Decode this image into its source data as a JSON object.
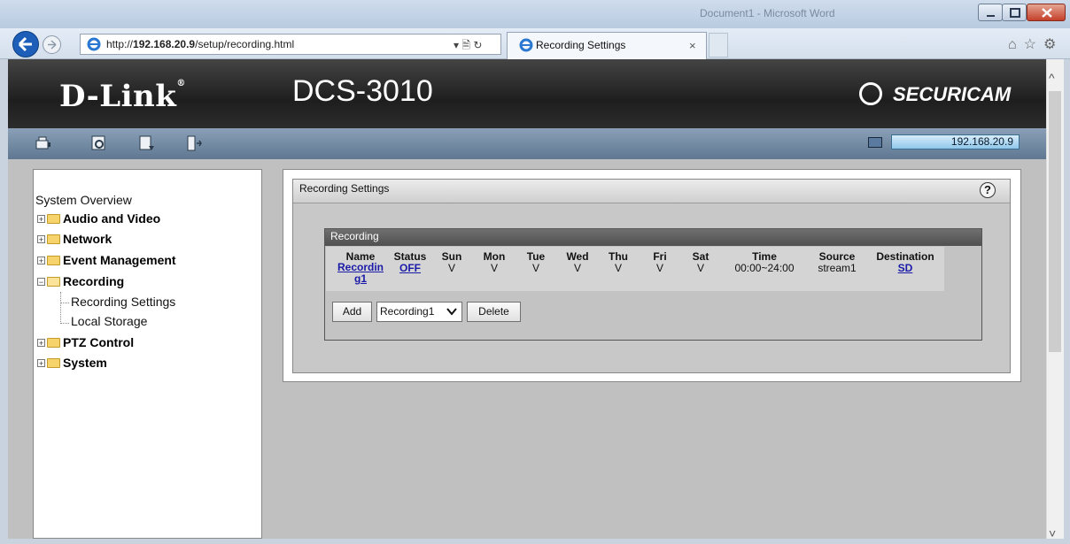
{
  "window": {
    "title": "Document1 - Microsoft Word"
  },
  "browser": {
    "address_prefix": "http://",
    "address_host": "192.168.20.9",
    "address_path": "/setup/recording.html",
    "address_controls": "▾ 🗎 ↻",
    "tab_title": "Recording Settings",
    "tab_close": "×"
  },
  "header": {
    "logo": "D-Link",
    "logo_mark": "®",
    "model": "DCS-3010",
    "brand": "SECURICAM"
  },
  "menubar": {
    "icons": [
      "camera-icon",
      "live-view-icon",
      "setup-icon",
      "logout-icon"
    ],
    "ip": "192.168.20.9"
  },
  "tree": {
    "overview": "System Overview",
    "items": [
      {
        "label": "Audio and Video",
        "expander": "+"
      },
      {
        "label": "Network",
        "expander": "+"
      },
      {
        "label": "Event Management",
        "expander": "+"
      },
      {
        "label": "Recording",
        "expander": "−"
      },
      {
        "label": "PTZ Control",
        "expander": "+"
      },
      {
        "label": "System",
        "expander": "+"
      }
    ],
    "recording_children": [
      "Recording Settings",
      "Local Storage"
    ]
  },
  "main": {
    "section_title": "Recording Settings",
    "help": "?",
    "recording": {
      "title": "Recording",
      "columns": [
        "Name",
        "Status",
        "Sun",
        "Mon",
        "Tue",
        "Wed",
        "Thu",
        "Fri",
        "Sat",
        "Time",
        "Source",
        "Destination"
      ],
      "row": {
        "name_line1": "Recordin",
        "name_line2": "g1",
        "status": "OFF",
        "days": [
          "V",
          "V",
          "V",
          "V",
          "V",
          "V",
          "V"
        ],
        "time": "00:00~24:00",
        "source": "stream1",
        "destination": "SD"
      },
      "add_label": "Add",
      "select_value": "Recording1",
      "delete_label": "Delete"
    }
  }
}
